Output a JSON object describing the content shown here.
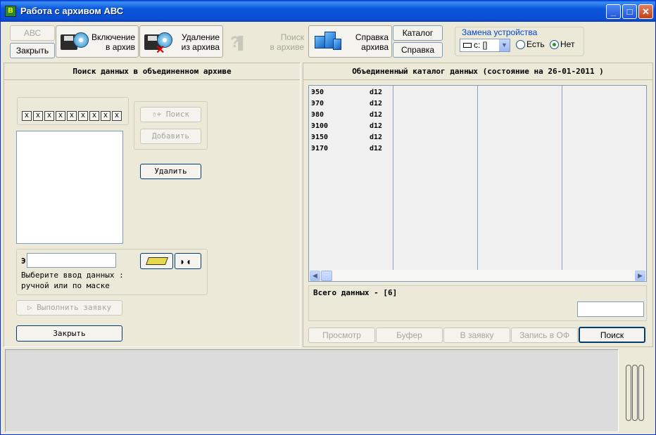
{
  "window": {
    "title": "Работа с архивом АВС",
    "icon": "app-icon",
    "controls": [
      "minimize-icon",
      "maximize-icon",
      "close-icon"
    ],
    "control_glyphs": {
      "min": "_",
      "max": "□",
      "close": "✕"
    }
  },
  "toolbar": {
    "abc_label": "АВС",
    "close_label": "Закрыть",
    "include": {
      "line1": "Включение",
      "line2": "в архив"
    },
    "delete": {
      "line1": "Удаление",
      "line2": "из архива"
    },
    "search": {
      "line1": "Поиск",
      "line2": "в архиве"
    },
    "help": {
      "line1": "Справка",
      "line2": "архива"
    },
    "catalog_label": "Каталог",
    "help_label": "Справка"
  },
  "device": {
    "group_title": "Замена устройства",
    "drive_value": "c: []",
    "radio_yes": "Есть",
    "radio_no": "Нет",
    "selected": "Нет"
  },
  "left_panel": {
    "title": "Поиск данных в объединенном архиве",
    "x_marks": [
      "x",
      "x",
      "x",
      "x",
      "x",
      "x",
      "x",
      "x",
      "x"
    ],
    "search_btn": "Поиск",
    "search_btn_icon": "⇧+",
    "add_btn": "Добавить",
    "delete_btn": "Удалить",
    "input_prefix": "Э",
    "input_value": "",
    "hint_line1": "Выберите ввод данных :",
    "hint_line2": "ручной или по маске",
    "execute_btn": "Выполнить заявку",
    "close_btn": "Закрыть"
  },
  "right_panel": {
    "title": "Объединенный каталог данных (состояние на 26-01-2011 )",
    "rows": [
      {
        "name": "Э50",
        "code": "d12"
      },
      {
        "name": "Э70",
        "code": "d12"
      },
      {
        "name": "Э80",
        "code": "d12"
      },
      {
        "name": "Э100",
        "code": "d12"
      },
      {
        "name": "Э150",
        "code": "d12"
      },
      {
        "name": "Э170",
        "code": "d12"
      }
    ],
    "total_label": "Всего данных - [6]",
    "total_input": "",
    "buttons": [
      "Просмотр",
      "Буфер",
      "В заявку",
      "Запись в ОФ",
      "Поиск"
    ]
  },
  "colors": {
    "titlebar": "#0a55dd",
    "face": "#ece9d8",
    "accent_blue": "#0046d5",
    "disabled_text": "#a7a69a",
    "radio_dot": "#21a121"
  }
}
